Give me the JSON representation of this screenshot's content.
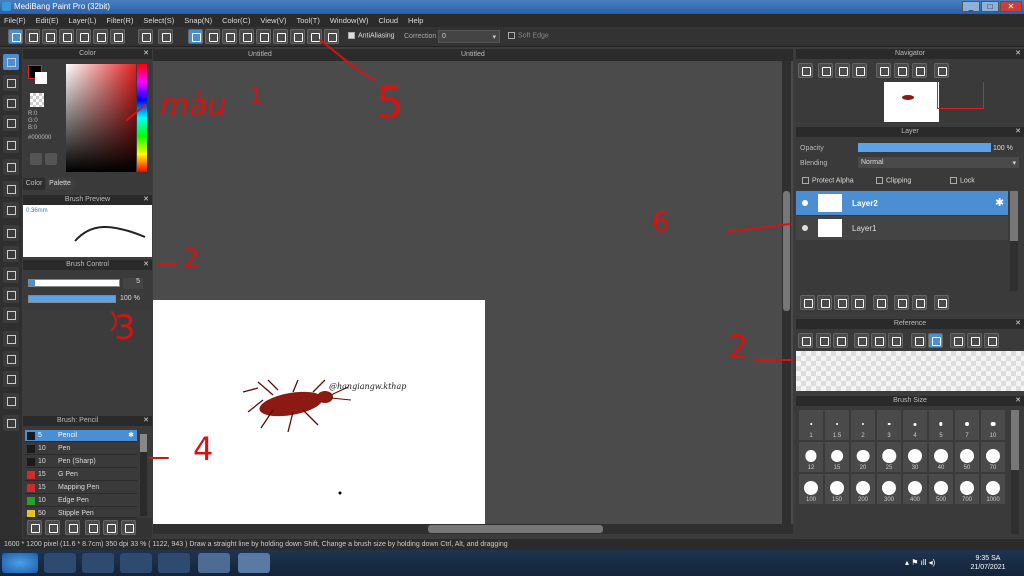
{
  "window": {
    "title": "MediBang Paint Pro (32bit)",
    "min": "_",
    "max": "□",
    "close": "✕"
  },
  "menu": [
    "File(F)",
    "Edit(E)",
    "Layer(L)",
    "Filter(R)",
    "Select(S)",
    "Snap(N)",
    "Color(C)",
    "View(V)",
    "Tool(T)",
    "Window(W)",
    "Cloud",
    "Help"
  ],
  "toolbar": {
    "antialiasing": "AntiAliasing",
    "correction_label": "Correction",
    "correction_value": "0",
    "soft_edge": "Soft Edge"
  },
  "tabs": [
    "Untitled",
    "Untitled"
  ],
  "color_panel": {
    "title": "Color",
    "r": "R:0",
    "g": "G:0",
    "b": "B:0",
    "hex": "#000000",
    "tab_color": "Color",
    "tab_palette": "Palette"
  },
  "brush_preview": {
    "title": "Brush Preview",
    "size": "0.36mm"
  },
  "brush_control": {
    "title": "Brush Control",
    "size": "5",
    "opacity": "100 %"
  },
  "brush_list": {
    "title": "Brush: Pencil",
    "items": [
      {
        "size": "5",
        "name": "Pencil",
        "color": "#1a1a1a"
      },
      {
        "size": "10",
        "name": "Pen",
        "color": "#1a1a1a"
      },
      {
        "size": "10",
        "name": "Pen (Sharp)",
        "color": "#1a1a1a"
      },
      {
        "size": "15",
        "name": "G Pen",
        "color": "#d32a2a"
      },
      {
        "size": "15",
        "name": "Mapping Pen",
        "color": "#d32a2a"
      },
      {
        "size": "10",
        "name": "Edge Pen",
        "color": "#2aa02a"
      },
      {
        "size": "50",
        "name": "Stipple Pen",
        "color": "#e5c22a"
      }
    ]
  },
  "navigator": {
    "title": "Navigator"
  },
  "layer": {
    "title": "Layer",
    "opacity_label": "Opacity",
    "opacity_value": "100 %",
    "blending_label": "Blending",
    "blending_value": "Normal",
    "protect_alpha": "Protect Alpha",
    "clipping": "Clipping",
    "lock": "Lock",
    "layers": [
      "Layer2",
      "Layer1"
    ]
  },
  "reference": {
    "title": "Reference"
  },
  "brush_size": {
    "title": "Brush Size",
    "sizes": [
      "1",
      "1.5",
      "2",
      "3",
      "4",
      "5",
      "7",
      "10",
      "12",
      "15",
      "20",
      "25",
      "30",
      "40",
      "50",
      "70",
      "100",
      "150",
      "200",
      "300",
      "400",
      "500",
      "700",
      "1000"
    ]
  },
  "canvas_text": "@hangiangw.kthap",
  "status": {
    "text": "1600 * 1200 pixel   (11.6 * 8.7cm)   350 dpi   33 %   ( 1122, 943 )   Draw a straight line by holding down Shift, Change a brush size by holding down Ctrl, Alt, and dragging"
  },
  "taskbar": {
    "time": "9:35 SA",
    "date": "21/07/2021"
  },
  "annotations": {
    "mau": "màu",
    "n1": "1",
    "n2": "2",
    "n3": "3",
    "n4": "4",
    "n5": "5",
    "n6": "6",
    "n2b": "2"
  },
  "colors": {
    "accent": "#4b8ed1",
    "panel": "#3a3a3a",
    "annotation": "#d31414"
  }
}
